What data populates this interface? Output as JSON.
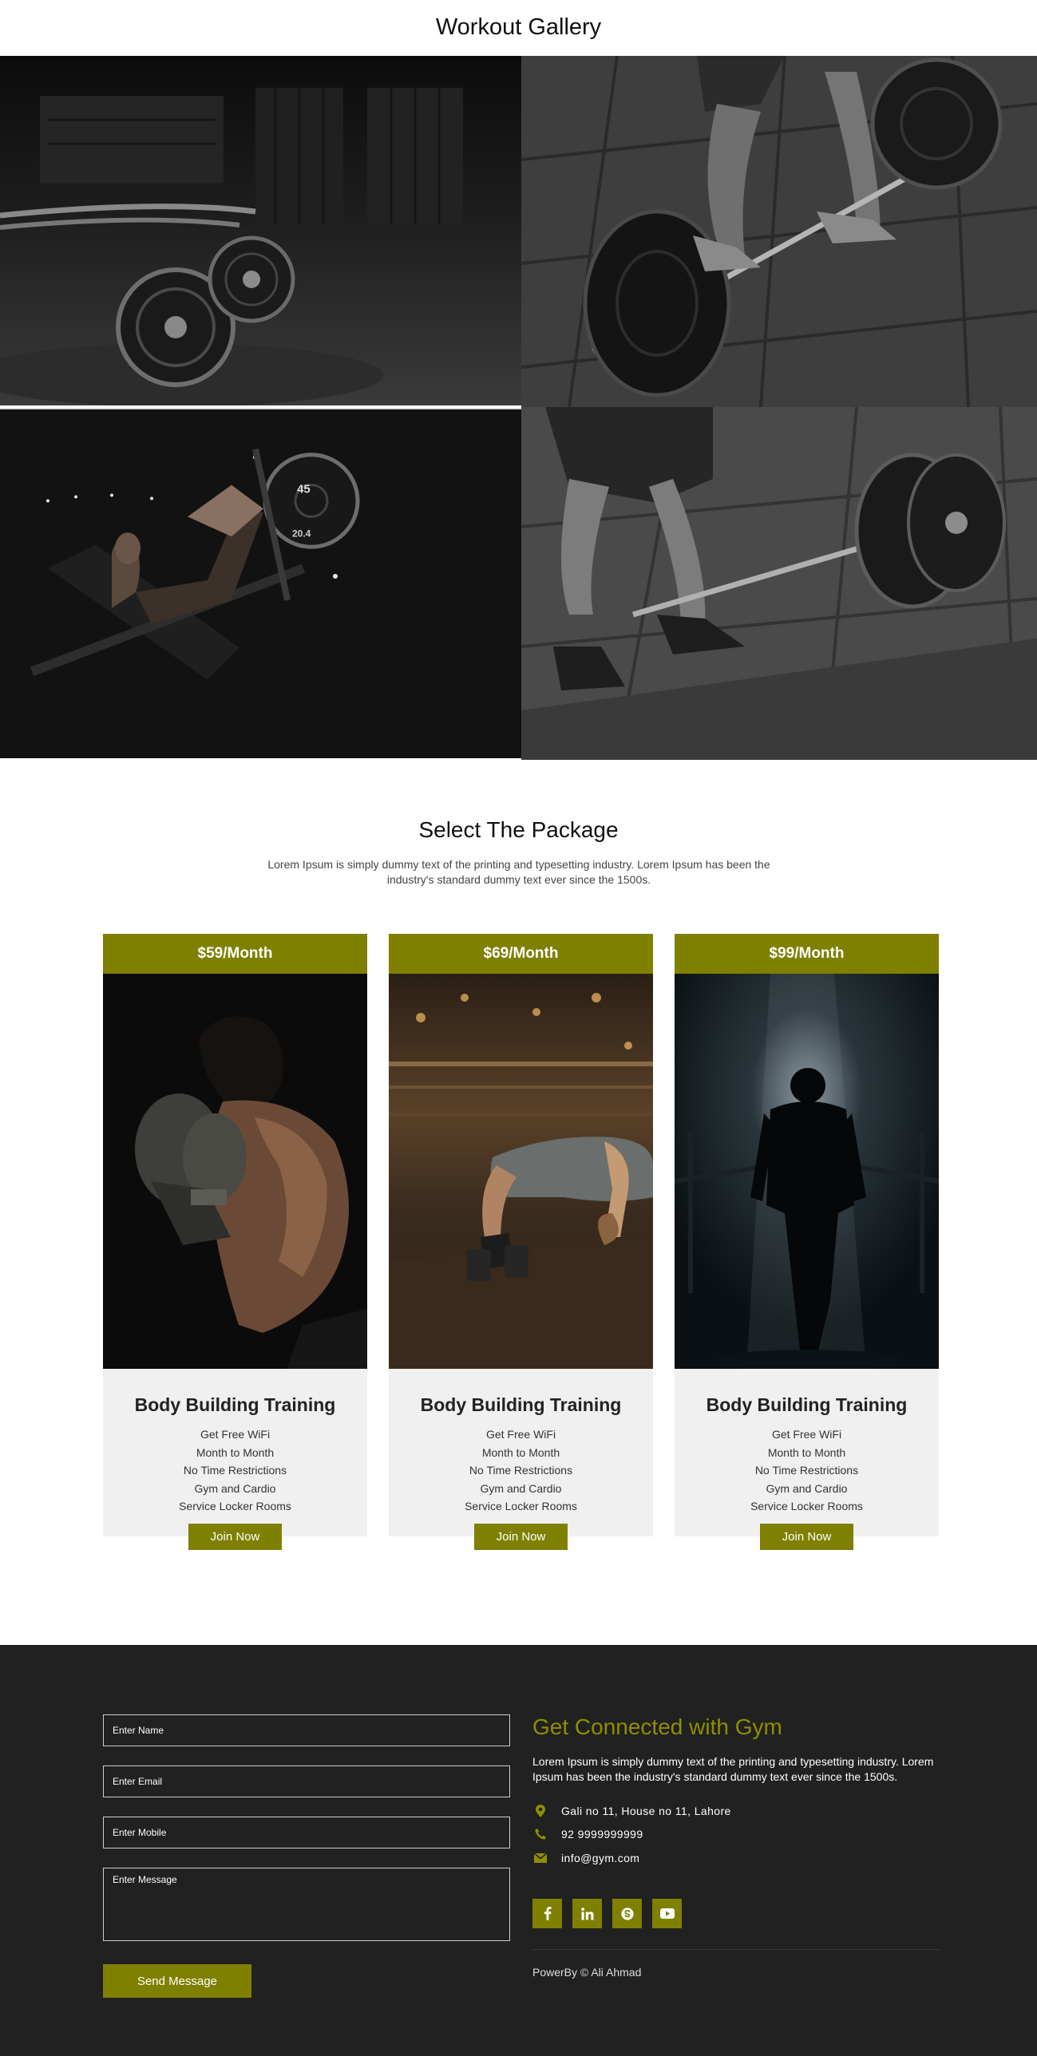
{
  "gallery": {
    "title": "Workout Gallery"
  },
  "packages": {
    "title": "Select The Package",
    "description": "Lorem Ipsum is simply dummy text of the printing and typesetting industry. Lorem Ipsum has been the industry's standard dummy text ever since the 1500s.",
    "cards": [
      {
        "price": "$59/Month",
        "name": "Body Building Training",
        "features": [
          "Get Free WiFi",
          "Month to Month",
          "No Time Restrictions",
          "Gym and Cardio",
          "Service Locker Rooms"
        ],
        "button": "Join Now"
      },
      {
        "price": "$69/Month",
        "name": "Body Building Training",
        "features": [
          "Get Free WiFi",
          "Month to Month",
          "No Time Restrictions",
          "Gym and Cardio",
          "Service Locker Rooms"
        ],
        "button": "Join Now"
      },
      {
        "price": "$99/Month",
        "name": "Body Building Training",
        "features": [
          "Get Free WiFi",
          "Month to Month",
          "No Time Restrictions",
          "Gym and Cardio",
          "Service Locker Rooms"
        ],
        "button": "Join Now"
      }
    ]
  },
  "contact_form": {
    "name_placeholder": "Enter Name",
    "email_placeholder": "Enter Email",
    "mobile_placeholder": "Enter Mobile",
    "message_placeholder": "Enter Message",
    "send_label": "Send Message"
  },
  "connect": {
    "title": "Get Connected with Gym",
    "description": "Lorem Ipsum is simply dummy text of the printing and typesetting industry. Lorem Ipsum has been the industry's standard dummy text ever since the 1500s.",
    "address": "Gali no 11, House no 11, Lahore",
    "phone": "92 9999999999",
    "email": "info@gym.com",
    "social_icons": [
      "facebook-icon",
      "linkedin-icon",
      "skype-icon",
      "youtube-icon"
    ],
    "powered_by": "PowerBy © Ali Ahmad"
  },
  "colors": {
    "accent": "#7f8000",
    "footer_bg": "#212121",
    "card_bg": "#f0f0f0"
  }
}
